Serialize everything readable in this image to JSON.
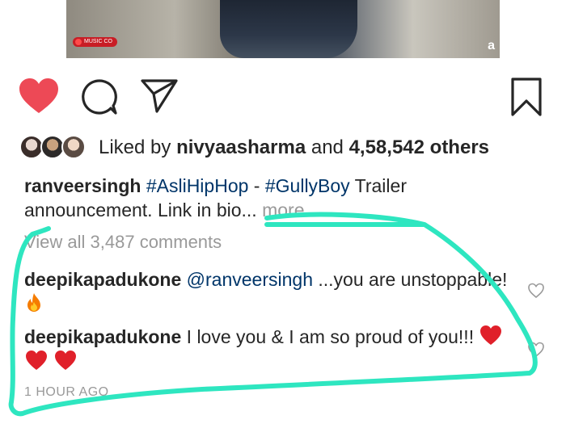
{
  "media": {
    "badge_text": "MUSIC CO",
    "corner_mark": "a"
  },
  "actions": {
    "like_icon": "heart-filled-icon",
    "comment_icon": "comment-bubble-icon",
    "share_icon": "send-arrow-icon",
    "save_icon": "bookmark-icon",
    "like_color": "#ed4956"
  },
  "likes": {
    "prefix": "Liked by ",
    "user": "nivyaasharma",
    "connector": " and ",
    "count": "4,58,542 others"
  },
  "caption": {
    "username": "ranveersingh",
    "tag1": "#AsliHipHop",
    "separator": " - ",
    "tag2": "#GullyBoy",
    "text_line1": " Trailer",
    "text_line2": "announcement. Link in bio...",
    "more_label": " more"
  },
  "comments_link": "View all 3,487 comments",
  "comments": [
    {
      "username": "deepikapadukone",
      "mention": "@ranveersingh",
      "text": " ...you are unstoppable!",
      "emoji": "fire"
    },
    {
      "username": "deepikapadukone",
      "text": " I love you & I am so proud of you!!!",
      "emoji": "heart×3"
    }
  ],
  "timestamp": "1 HOUR AGO",
  "annotation_color": "#2ee6c0"
}
